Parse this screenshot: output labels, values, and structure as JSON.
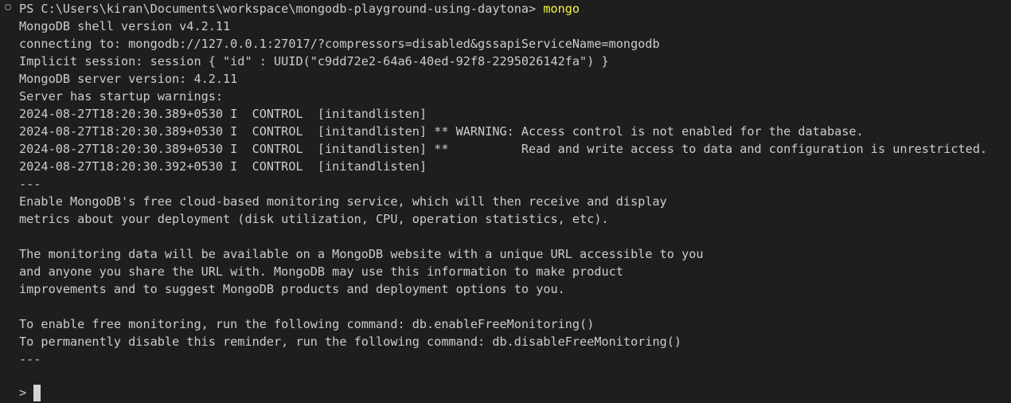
{
  "terminal": {
    "prompt_path": "PS C:\\Users\\kiran\\Documents\\workspace\\mongodb-playground-using-daytona> ",
    "command": "mongo",
    "output": [
      "MongoDB shell version v4.2.11",
      "connecting to: mongodb://127.0.0.1:27017/?compressors=disabled&gssapiServiceName=mongodb",
      "Implicit session: session { \"id\" : UUID(\"c9dd72e2-64a6-40ed-92f8-2295026142fa\") }",
      "MongoDB server version: 4.2.11",
      "Server has startup warnings:",
      "2024-08-27T18:20:30.389+0530 I  CONTROL  [initandlisten]",
      "2024-08-27T18:20:30.389+0530 I  CONTROL  [initandlisten] ** WARNING: Access control is not enabled for the database.",
      "2024-08-27T18:20:30.389+0530 I  CONTROL  [initandlisten] **          Read and write access to data and configuration is unrestricted.",
      "2024-08-27T18:20:30.392+0530 I  CONTROL  [initandlisten]",
      "---",
      "Enable MongoDB's free cloud-based monitoring service, which will then receive and display",
      "metrics about your deployment (disk utilization, CPU, operation statistics, etc).",
      "",
      "The monitoring data will be available on a MongoDB website with a unique URL accessible to you",
      "and anyone you share the URL with. MongoDB may use this information to make product",
      "improvements and to suggest MongoDB products and deployment options to you.",
      "",
      "To enable free monitoring, run the following command: db.enableFreeMonitoring()",
      "To permanently disable this reminder, run the following command: db.disableFreeMonitoring()",
      "---"
    ],
    "shell_prompt": ">",
    "input_value": ""
  },
  "colors": {
    "background": "#1e1e1e",
    "text": "#cccccc",
    "command": "#f5f543",
    "cursor": "#d4d4d4"
  }
}
